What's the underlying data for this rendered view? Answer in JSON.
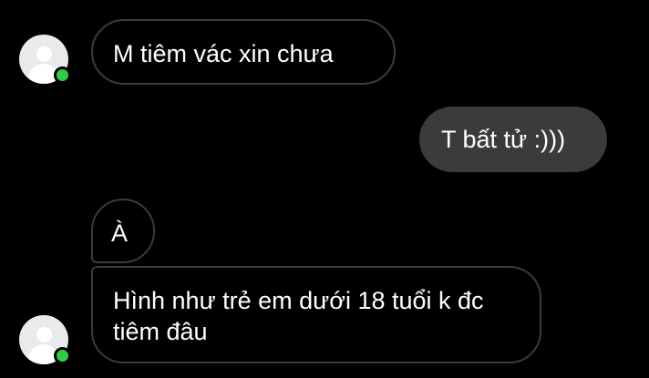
{
  "conversation": {
    "messages": [
      {
        "direction": "incoming",
        "text": "M tiêm vác xin chưa"
      },
      {
        "direction": "outgoing",
        "text": "T bất tử :)))"
      },
      {
        "direction": "incoming",
        "text": "À"
      },
      {
        "direction": "incoming",
        "text": "Hình như trẻ em dưới 18 tuổi k đc tiêm đâu"
      }
    ]
  },
  "colors": {
    "background": "#000000",
    "outgoing_bubble": "#3a3b3c",
    "incoming_border": "#3a3b3c",
    "online_dot": "#31cc46",
    "avatar_bg": "#e9eaec"
  }
}
